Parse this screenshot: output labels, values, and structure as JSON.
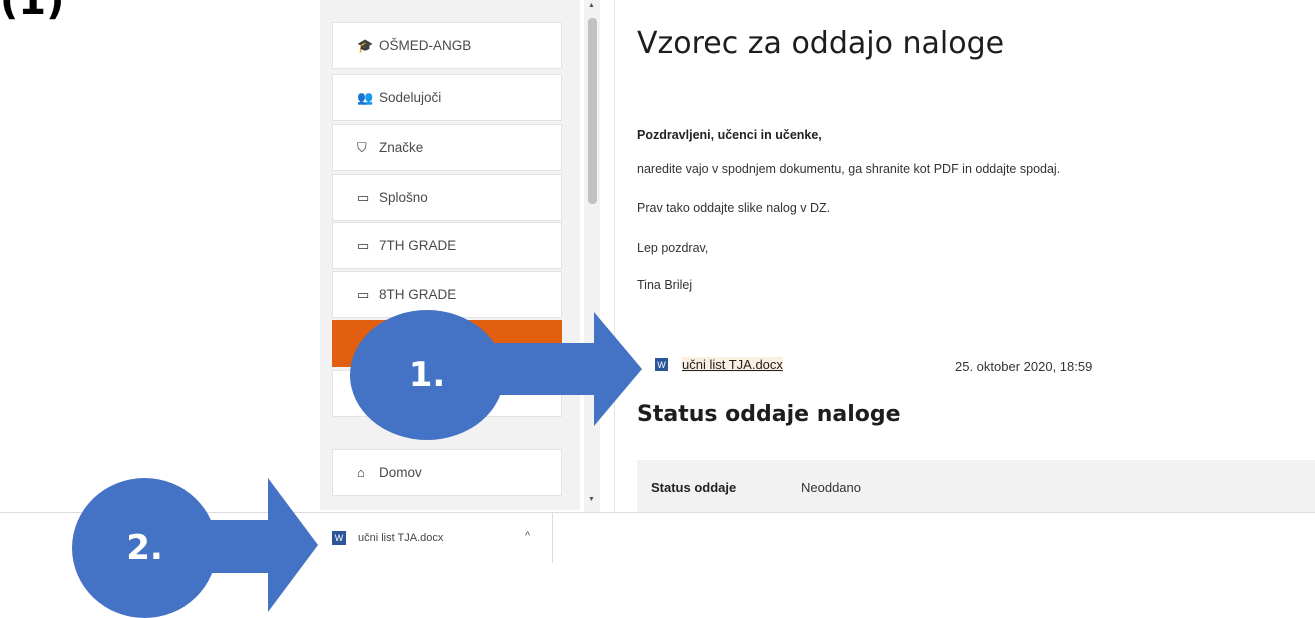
{
  "corner_mark": "(1)",
  "sidebar": {
    "items": [
      {
        "icon": "graduation-cap-icon",
        "glyph": "🎓",
        "label": "OŠMED-ANGB"
      },
      {
        "icon": "users-icon",
        "glyph": "👥",
        "label": "Sodelujoči"
      },
      {
        "icon": "shield-icon",
        "glyph": "⛉",
        "label": "Značke"
      },
      {
        "icon": "folder-icon",
        "glyph": "▭",
        "label": "Splošno"
      },
      {
        "icon": "folder-icon",
        "glyph": "▭",
        "label": "7TH GRADE"
      },
      {
        "icon": "folder-icon",
        "glyph": "▭",
        "label": "8TH GRADE"
      },
      {
        "icon": "folder-icon",
        "glyph": "",
        "label": ""
      },
      {
        "icon": "folder-icon",
        "glyph": "▭",
        "label": ""
      },
      {
        "icon": "home-icon",
        "glyph": "⌂",
        "label": "Domov"
      }
    ]
  },
  "main": {
    "title": "Vzorec za oddajo naloge",
    "greeting": "Pozdravljeni, učenci in učenke,",
    "paragraphs": [
      "naredite vajo v spodnjem dokumentu, ga shranite kot PDF in oddajte spodaj.",
      "Prav tako oddajte slike nalog v DZ.",
      "Lep pozdrav,",
      "Tina Brilej"
    ],
    "attachment": {
      "name": "učni list TJA.docx",
      "date": "25. oktober 2020, 18:59"
    },
    "section_title": "Status oddaje naloge",
    "status": {
      "label": "Status oddaje",
      "value": "Neoddano"
    }
  },
  "download_bar": {
    "file_name": "učni list TJA.docx",
    "chevron": "^"
  },
  "annotations": [
    "1.",
    "2."
  ],
  "colors": {
    "accent_orange": "#e15f0e",
    "callout_blue": "#4472c4",
    "word_blue": "#2b579a"
  }
}
